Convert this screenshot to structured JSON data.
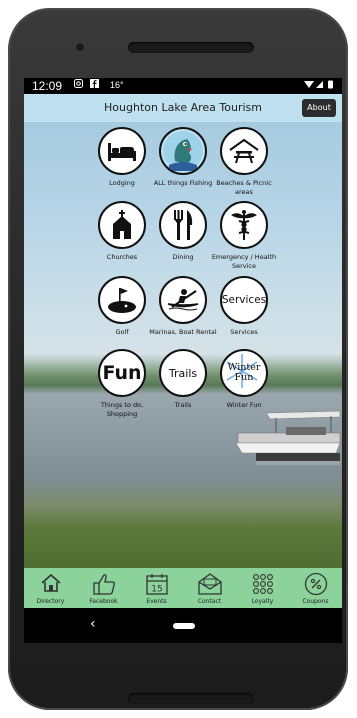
{
  "status_bar": {
    "time": "12:09",
    "temperature": "16°"
  },
  "app_bar": {
    "title": "Houghton Lake Area Tourism",
    "about_label": "About"
  },
  "tiles": [
    {
      "label": "Lodging",
      "icon": "bed-icon"
    },
    {
      "label": "ALL things Fishing",
      "icon": "fish-icon"
    },
    {
      "label": "Beaches & Picnic areas",
      "icon": "picnic-table-icon"
    },
    {
      "label": "Churches",
      "icon": "church-icon"
    },
    {
      "label": "Dining",
      "icon": "fork-knife-icon"
    },
    {
      "label": "Emergency / Health Service",
      "icon": "caduceus-icon"
    },
    {
      "label": "Golf",
      "icon": "golf-icon"
    },
    {
      "label": "Marinas, Boat Rental",
      "icon": "kayak-icon"
    },
    {
      "label": "Services",
      "icon": "services-text",
      "icon_text": "Services"
    },
    {
      "label": "Things to do, Shopping",
      "icon": "fun-text",
      "icon_text": "Fun"
    },
    {
      "label": "Trails",
      "icon": "trails-text",
      "icon_text": "Trails"
    },
    {
      "label": "Winter Fun",
      "icon": "winter-fun-text",
      "icon_text": "Winter Fun"
    }
  ],
  "bottom_nav": [
    {
      "label": "Directory",
      "icon": "home-icon"
    },
    {
      "label": "Facebook",
      "icon": "thumbs-up-icon"
    },
    {
      "label": "Events",
      "icon": "calendar-icon",
      "icon_text": "15"
    },
    {
      "label": "Contact",
      "icon": "envelope-icon"
    },
    {
      "label": "Loyalty",
      "icon": "dots-grid-icon"
    },
    {
      "label": "Coupons",
      "icon": "percent-icon"
    }
  ],
  "colors": {
    "app_bar": "#bfe0ef",
    "bottom_nav": "#8bd39a",
    "phone_body": "#262626"
  }
}
